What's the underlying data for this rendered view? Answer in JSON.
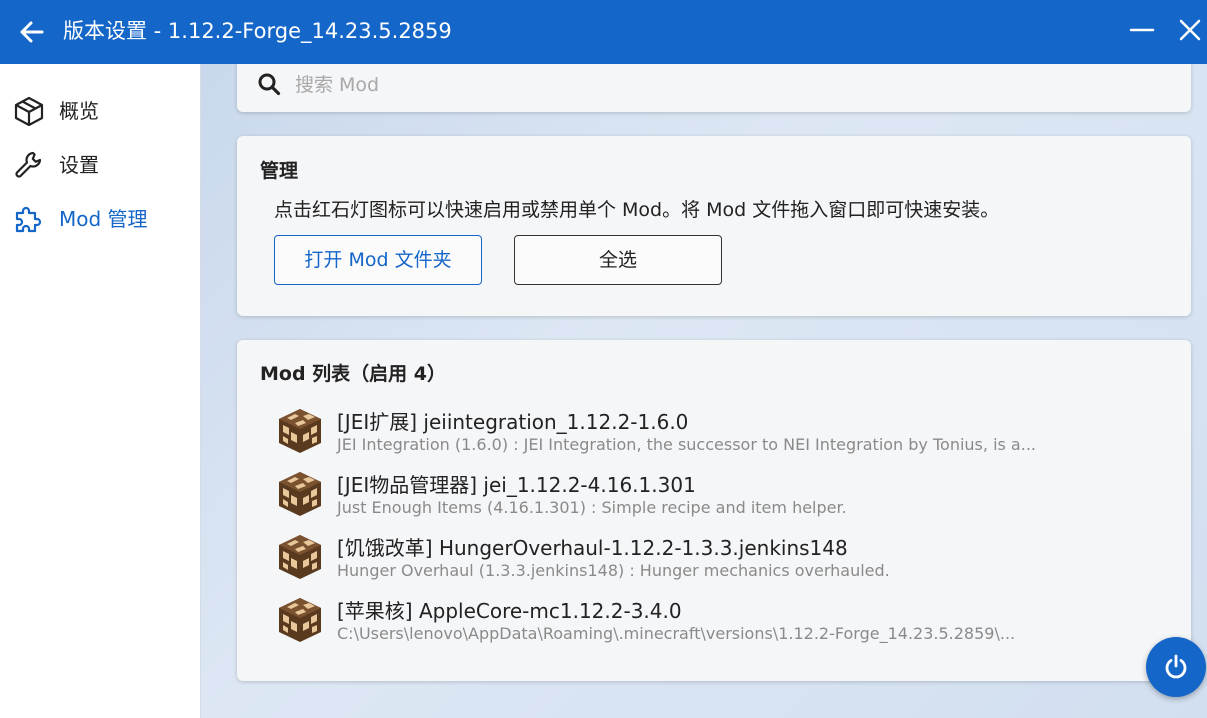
{
  "titlebar": {
    "title": "版本设置 - 1.12.2-Forge_14.23.5.2859",
    "back_icon": "arrow-left-icon",
    "minimize_icon": "minimize-icon",
    "close_icon": "close-icon"
  },
  "sidebar": {
    "items": [
      {
        "label": "概览",
        "icon": "cube-icon",
        "active": false
      },
      {
        "label": "设置",
        "icon": "wrench-icon",
        "active": false
      },
      {
        "label": "Mod 管理",
        "icon": "puzzle-icon",
        "active": true
      }
    ]
  },
  "search": {
    "placeholder": "搜索 Mod",
    "value": ""
  },
  "manage": {
    "title": "管理",
    "description": "点击红石灯图标可以快速启用或禁用单个 Mod。将 Mod 文件拖入窗口即可快速安装。",
    "open_folder_label": "打开 Mod 文件夹",
    "select_all_label": "全选"
  },
  "mod_list": {
    "title": "Mod 列表（启用 4）",
    "items": [
      {
        "title": "[JEI扩展] jeiintegration_1.12.2-1.6.0",
        "desc": "JEI Integration (1.6.0) : JEI Integration, the successor to NEI Integration by Tonius, is a..."
      },
      {
        "title": "[JEI物品管理器] jei_1.12.2-4.16.1.301",
        "desc": "Just Enough Items (4.16.1.301) : Simple recipe and item helper."
      },
      {
        "title": "[饥饿改革] HungerOverhaul-1.12.2-1.3.3.jenkins148",
        "desc": "Hunger Overhaul (1.3.3.jenkins148) : Hunger mechanics overhauled."
      },
      {
        "title": "[苹果核] AppleCore-mc1.12.2-3.4.0",
        "desc": "C:\\Users\\lenovo\\AppData\\Roaming\\.minecraft\\versions\\1.12.2-Forge_14.23.5.2859\\..."
      }
    ]
  },
  "fab": {
    "icon": "power-icon"
  },
  "colors": {
    "accent": "#1466c9",
    "lamp_dark": "#5a3a1f",
    "lamp_light": "#e8c79a"
  }
}
